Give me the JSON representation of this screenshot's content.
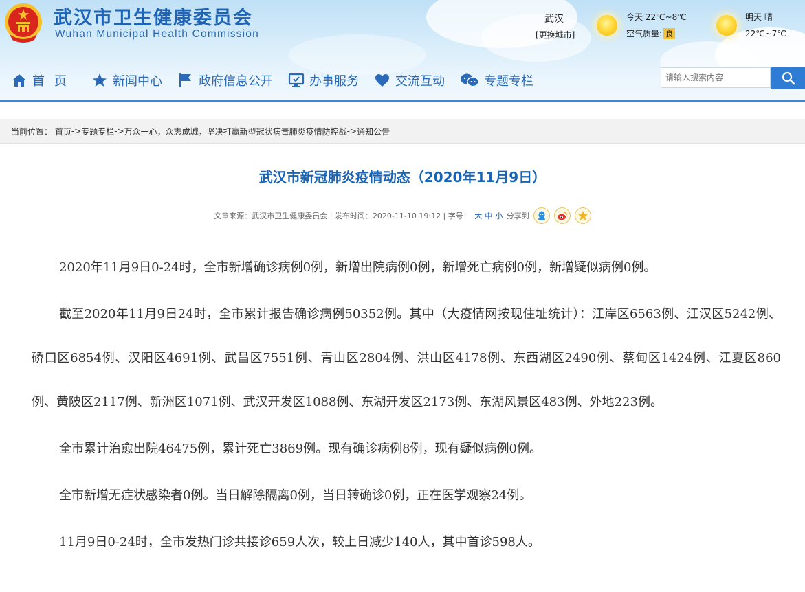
{
  "header": {
    "site_name_cn": "武汉市卫生健康委员会",
    "site_name_en": "Wuhan Municipal Health Commission",
    "colors": {
      "brand_blue": "#1f63b5",
      "nav_blue": "#2a6ab8",
      "emblem_red": "#d9261c",
      "emblem_gold": "#f6c12c"
    }
  },
  "weather": {
    "city": "武汉",
    "change_city": "[更换城市]",
    "today_label": "今天",
    "today_temp": "22℃~8℃",
    "air_quality_label": "空气质量:",
    "air_quality_value": "良",
    "tomorrow_label": "明天",
    "tomorrow_condition": "晴",
    "tomorrow_temp": "22℃~7℃",
    "icon": "sun-icon"
  },
  "nav": {
    "items": [
      {
        "label": "首页",
        "icon": "home-icon"
      },
      {
        "label": "新闻中心",
        "icon": "star-icon"
      },
      {
        "label": "政府信息公开",
        "icon": "flag-icon"
      },
      {
        "label": "办事服务",
        "icon": "monitor-icon"
      },
      {
        "label": "交流互动",
        "icon": "heart-icon"
      },
      {
        "label": "专题专栏",
        "icon": "chat-icon"
      }
    ]
  },
  "search": {
    "placeholder": "请输入搜索内容",
    "icon": "search-icon"
  },
  "breadcrumb": {
    "prefix": "当前位置：",
    "items": [
      "首页",
      "专题专栏",
      "万众一心，众志成城，坚决打赢新型冠状病毒肺炎疫情防控战",
      "通知公告"
    ],
    "separator": "->"
  },
  "article": {
    "title": "武汉市新冠肺炎疫情动态（2020年11月9日）",
    "meta": {
      "source_label": "文章来源：",
      "source": "武汉市卫生健康委员会",
      "publish_label": "发布时间：",
      "publish_time": "2020-11-10 19:12",
      "font_label": "字号：",
      "font_sizes": [
        "大",
        "中",
        "小"
      ],
      "share_label": "分享到",
      "share_icons": [
        "qq-icon",
        "weibo-icon",
        "favorite-star-icon"
      ]
    },
    "paragraphs": [
      "2020年11月9日0-24时，全市新增确诊病例0例，新增出院病例0例，新增死亡病例0例，新增疑似病例0例。",
      "截至2020年11月9日24时，全市累计报告确诊病例50352例。其中（大疫情网按现住址统计）：江岸区6563例、江汉区5242例、硚口区6854例、汉阳区4691例、武昌区7551例、青山区2804例、洪山区4178例、东西湖区2490例、蔡甸区1424例、江夏区860例、黄陂区2117例、新洲区1071例、武汉开发区1088例、东湖开发区2173例、东湖风景区483例、外地223例。",
      "全市累计治愈出院46475例，累计死亡3869例。现有确诊病例8例，现有疑似病例0例。",
      "全市新增无症状感染者0例。当日解除隔离0例，当日转确诊0例，正在医学观察24例。",
      "11月9日0-24时，全市发热门诊共接诊659人次，较上日减少140人，其中首诊598人。"
    ]
  }
}
